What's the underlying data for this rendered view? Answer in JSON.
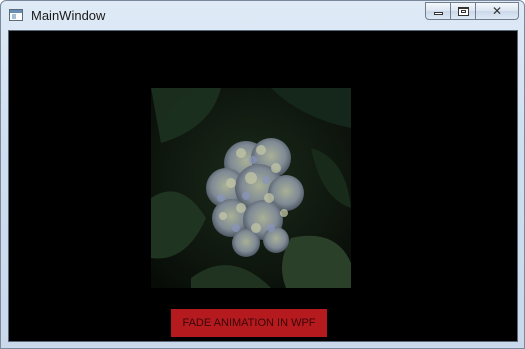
{
  "window": {
    "title": "MainWindow",
    "icon": "window-app-icon",
    "controls": {
      "minimize_icon": "minimize-icon",
      "maximize_icon": "maximize-icon",
      "close_icon": "close-icon",
      "close_glyph": "✕"
    }
  },
  "content": {
    "image_subject": "hydrangea flower photo",
    "background_color": "#000000",
    "fade_button": {
      "label": "FADE ANIMATION IN WPF",
      "background_color": "#b51a1f"
    }
  }
}
